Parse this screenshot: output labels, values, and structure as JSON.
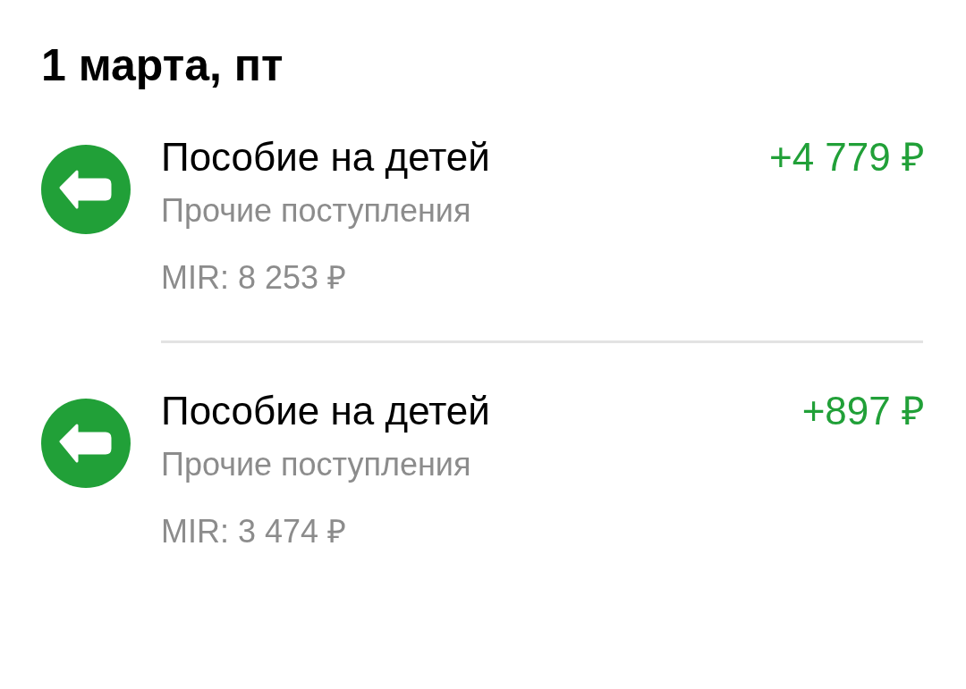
{
  "date_heading": "1 марта, пт",
  "transactions": [
    {
      "title": "Пособие на детей",
      "category": "Прочие поступления",
      "amount": "+4 779 ₽",
      "balance": "MIR: 8 253 ₽"
    },
    {
      "title": "Пособие на детей",
      "category": "Прочие поступления",
      "amount": "+897 ₽",
      "balance": "MIR: 3 474 ₽"
    }
  ]
}
